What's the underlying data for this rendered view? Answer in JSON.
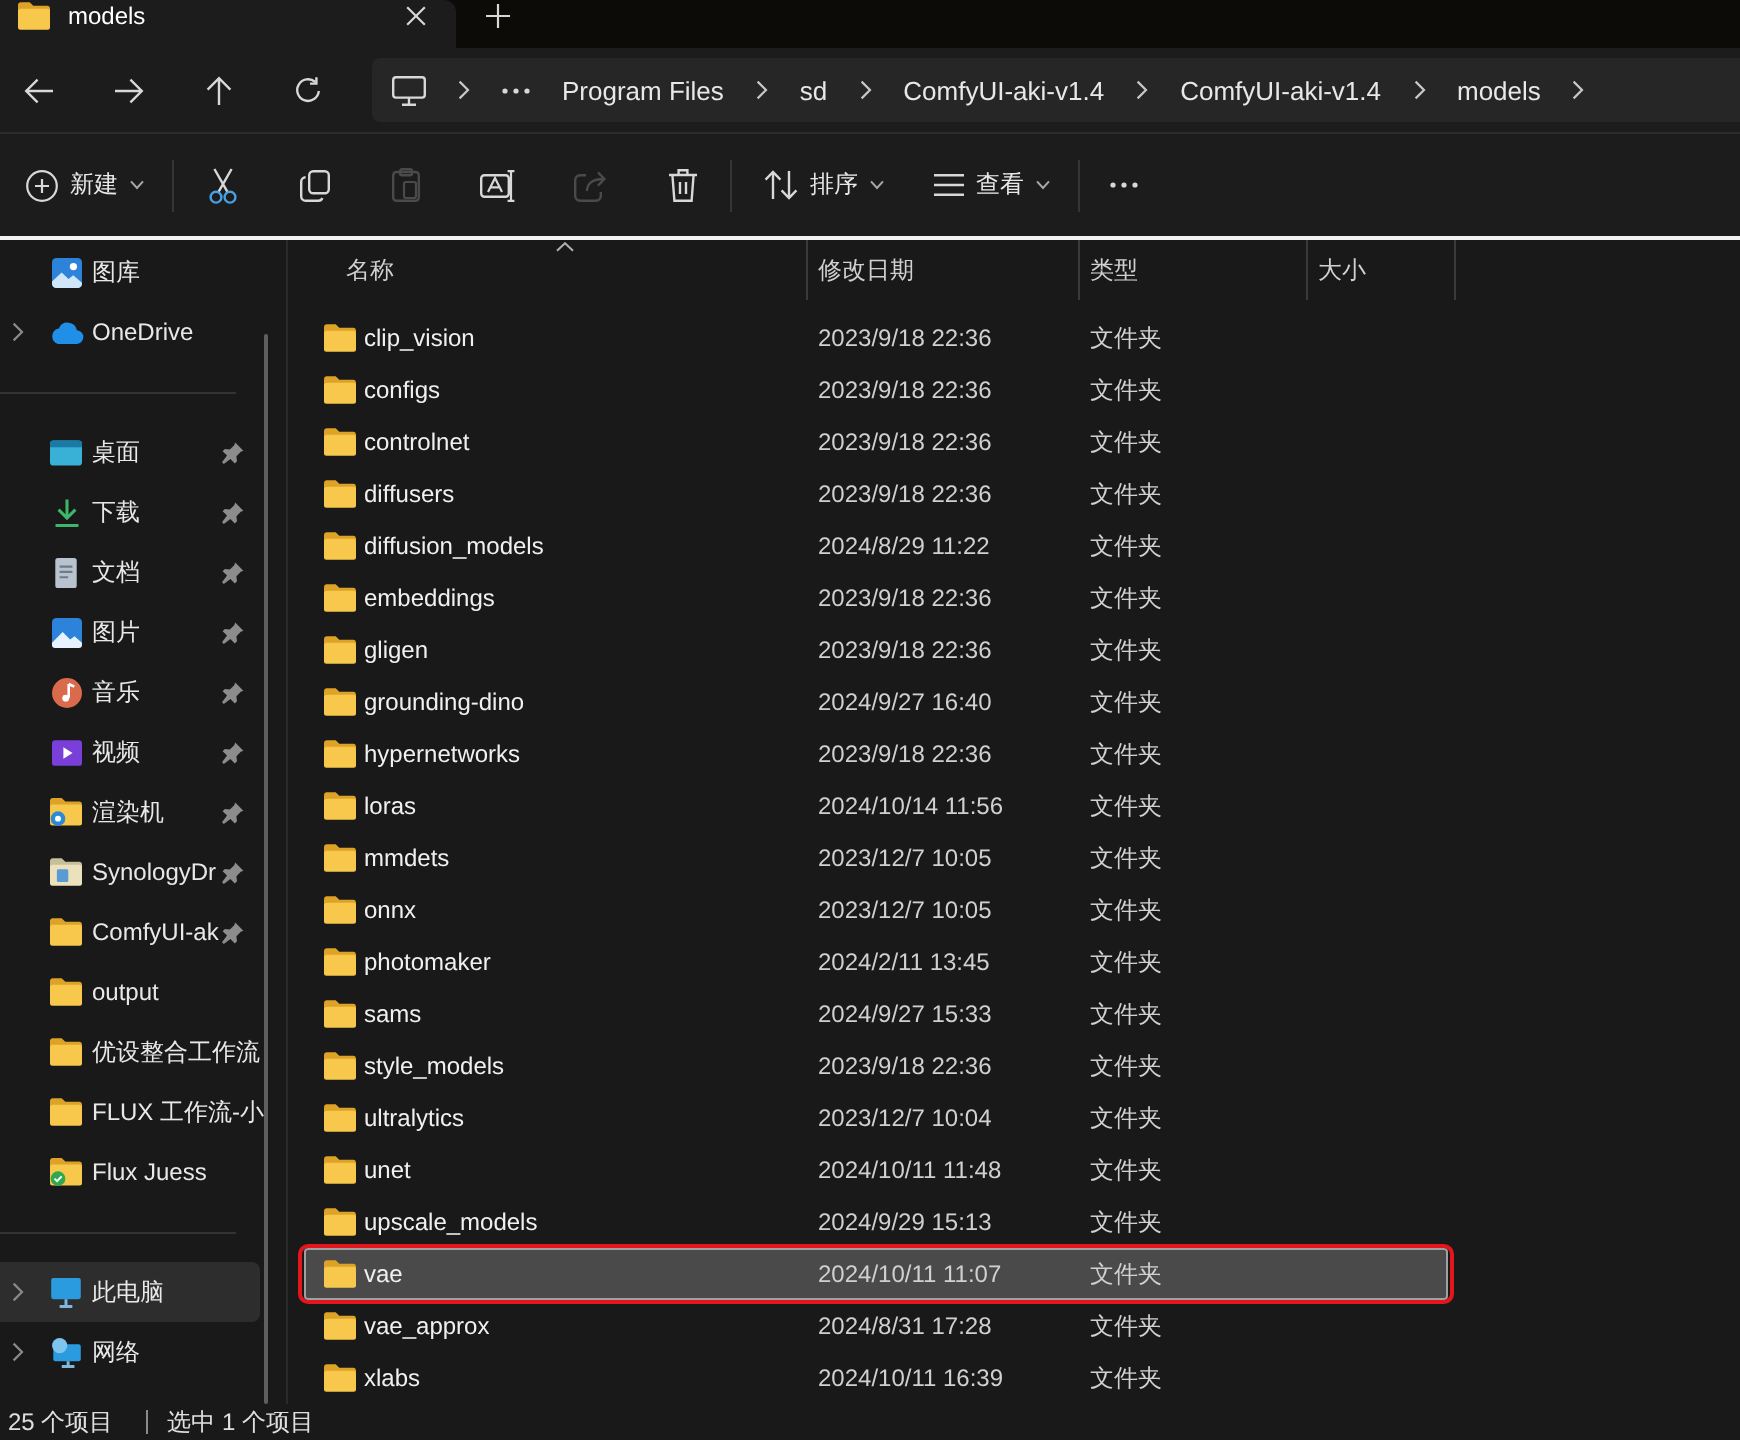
{
  "tabs": [
    {
      "title": "models",
      "selected": true
    }
  ],
  "address_bar": {
    "breadcrumbs": [
      "Program Files",
      "sd",
      "ComfyUI-aki-v1.4",
      "ComfyUI-aki-v1.4",
      "models"
    ]
  },
  "command_bar": {
    "new": {
      "label": "新建"
    },
    "actions": [
      {
        "kind": "cut",
        "disabled": false
      },
      {
        "kind": "copy",
        "disabled": false
      },
      {
        "kind": "paste",
        "disabled": true
      },
      {
        "kind": "rename",
        "disabled": false
      },
      {
        "kind": "share",
        "disabled": true
      },
      {
        "kind": "delete",
        "disabled": false
      }
    ],
    "sort": {
      "label": "排序"
    },
    "view": {
      "label": "查看"
    }
  },
  "sidebar": {
    "sections": [
      {
        "items": [
          {
            "label": "图库",
            "kind": "gallery",
            "expandable": false,
            "pinned": false,
            "selected": false
          },
          {
            "label": "OneDrive",
            "kind": "cloud",
            "expandable": true,
            "pinned": false,
            "selected": false
          }
        ]
      },
      {
        "items": [
          {
            "label": "桌面",
            "kind": "desktop",
            "expandable": false,
            "pinned": true,
            "selected": false
          },
          {
            "label": "下载",
            "kind": "downloads",
            "expandable": false,
            "pinned": true,
            "selected": false
          },
          {
            "label": "文档",
            "kind": "documents",
            "expandable": false,
            "pinned": true,
            "selected": false
          },
          {
            "label": "图片",
            "kind": "pictures",
            "expandable": false,
            "pinned": true,
            "selected": false
          },
          {
            "label": "音乐",
            "kind": "music",
            "expandable": false,
            "pinned": true,
            "selected": false
          },
          {
            "label": "视频",
            "kind": "videos",
            "expandable": false,
            "pinned": true,
            "selected": false
          },
          {
            "label": "渲染机",
            "kind": "netfolder",
            "expandable": false,
            "pinned": true,
            "selected": false
          },
          {
            "label": "SynologyDr",
            "kind": "synology",
            "expandable": false,
            "pinned": true,
            "selected": false
          },
          {
            "label": "ComfyUI-ak",
            "kind": "folder",
            "expandable": false,
            "pinned": true,
            "selected": false
          },
          {
            "label": "output",
            "kind": "folder",
            "expandable": false,
            "pinned": false,
            "selected": false
          },
          {
            "label": "优设整合工作流",
            "kind": "folder",
            "expandable": false,
            "pinned": false,
            "selected": false
          },
          {
            "label": "FLUX 工作流-小",
            "kind": "folder",
            "expandable": false,
            "pinned": false,
            "selected": false
          },
          {
            "label": "Flux Juess",
            "kind": "synced",
            "expandable": false,
            "pinned": false,
            "selected": false
          }
        ]
      },
      {
        "items": [
          {
            "label": "此电脑",
            "kind": "computer",
            "expandable": true,
            "pinned": false,
            "selected": true
          },
          {
            "label": "网络",
            "kind": "network",
            "expandable": true,
            "pinned": false,
            "selected": false
          }
        ]
      }
    ]
  },
  "file_list": {
    "columns": [
      {
        "label": "名称",
        "sorted": true
      },
      {
        "label": "修改日期",
        "sorted": false
      },
      {
        "label": "类型",
        "sorted": false
      },
      {
        "label": "大小",
        "sorted": false
      }
    ],
    "rows": [
      {
        "name": "clip_vision",
        "modified": "2023/9/18 22:36",
        "type": "文件夹",
        "selected": false,
        "highlighted": false
      },
      {
        "name": "configs",
        "modified": "2023/9/18 22:36",
        "type": "文件夹",
        "selected": false,
        "highlighted": false
      },
      {
        "name": "controlnet",
        "modified": "2023/9/18 22:36",
        "type": "文件夹",
        "selected": false,
        "highlighted": false
      },
      {
        "name": "diffusers",
        "modified": "2023/9/18 22:36",
        "type": "文件夹",
        "selected": false,
        "highlighted": false
      },
      {
        "name": "diffusion_models",
        "modified": "2024/8/29 11:22",
        "type": "文件夹",
        "selected": false,
        "highlighted": false
      },
      {
        "name": "embeddings",
        "modified": "2023/9/18 22:36",
        "type": "文件夹",
        "selected": false,
        "highlighted": false
      },
      {
        "name": "gligen",
        "modified": "2023/9/18 22:36",
        "type": "文件夹",
        "selected": false,
        "highlighted": false
      },
      {
        "name": "grounding-dino",
        "modified": "2024/9/27 16:40",
        "type": "文件夹",
        "selected": false,
        "highlighted": false
      },
      {
        "name": "hypernetworks",
        "modified": "2023/9/18 22:36",
        "type": "文件夹",
        "selected": false,
        "highlighted": false
      },
      {
        "name": "loras",
        "modified": "2024/10/14 11:56",
        "type": "文件夹",
        "selected": false,
        "highlighted": false
      },
      {
        "name": "mmdets",
        "modified": "2023/12/7 10:05",
        "type": "文件夹",
        "selected": false,
        "highlighted": false
      },
      {
        "name": "onnx",
        "modified": "2023/12/7 10:05",
        "type": "文件夹",
        "selected": false,
        "highlighted": false
      },
      {
        "name": "photomaker",
        "modified": "2024/2/11 13:45",
        "type": "文件夹",
        "selected": false,
        "highlighted": false
      },
      {
        "name": "sams",
        "modified": "2024/9/27 15:33",
        "type": "文件夹",
        "selected": false,
        "highlighted": false
      },
      {
        "name": "style_models",
        "modified": "2023/9/18 22:36",
        "type": "文件夹",
        "selected": false,
        "highlighted": false
      },
      {
        "name": "ultralytics",
        "modified": "2023/12/7 10:04",
        "type": "文件夹",
        "selected": false,
        "highlighted": false
      },
      {
        "name": "unet",
        "modified": "2024/10/11 11:48",
        "type": "文件夹",
        "selected": false,
        "highlighted": false
      },
      {
        "name": "upscale_models",
        "modified": "2024/9/29 15:13",
        "type": "文件夹",
        "selected": false,
        "highlighted": false
      },
      {
        "name": "vae",
        "modified": "2024/10/11 11:07",
        "type": "文件夹",
        "selected": true,
        "highlighted": true
      },
      {
        "name": "vae_approx",
        "modified": "2024/8/31 17:28",
        "type": "文件夹",
        "selected": false,
        "highlighted": false
      },
      {
        "name": "xlabs",
        "modified": "2024/10/11 16:39",
        "type": "文件夹",
        "selected": false,
        "highlighted": false
      }
    ]
  },
  "status_bar": {
    "item_count": "25 个项目",
    "selection": "选中 1 个项目"
  }
}
